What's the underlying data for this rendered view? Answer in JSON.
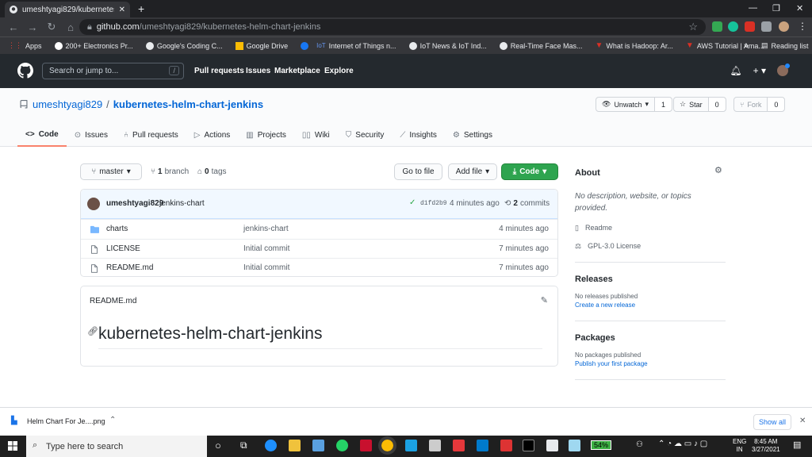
{
  "browser": {
    "tab_title": "umeshtyagi829/kubernetes-helm",
    "new_tab": "+",
    "window_controls": {
      "minimize": "—",
      "maximize": "❐",
      "close": "✕"
    },
    "url_host": "github.com",
    "url_path": "/umeshtyagi829/kubernetes-helm-chart-jenkins",
    "bookmarks": [
      {
        "label": "Apps",
        "color": "#ea4335"
      },
      {
        "label": "200+ Electronics Pr...",
        "color": "#ffffff"
      },
      {
        "label": "Google's Coding C...",
        "color": "#e8eaed"
      },
      {
        "label": "Google Drive",
        "color": "#fbbc04"
      },
      {
        "label": "Internet of Things n...",
        "color": "#1877f2"
      },
      {
        "label": "IoT News & IoT Ind...",
        "color": "#e8eaed"
      },
      {
        "label": "Real-Time Face Mas...",
        "color": "#e8eaed"
      },
      {
        "label": "What is Hadoop: Ar...",
        "color": "#d93025"
      },
      {
        "label": "AWS Tutorial | Ama...",
        "color": "#d93025"
      }
    ],
    "reading_list": "Reading list",
    "more": "»"
  },
  "github_header": {
    "search_placeholder": "Search or jump to...",
    "search_shortcut": "/",
    "nav": [
      "Pull requests",
      "Issues",
      "Marketplace",
      "Explore"
    ]
  },
  "repo": {
    "owner": "umeshtyagi829",
    "separator": "/",
    "name": "kubernetes-helm-chart-jenkins",
    "unwatch_label": "Unwatch",
    "watch_count": "1",
    "star_label": "Star",
    "star_count": "0",
    "fork_label": "Fork",
    "fork_count": "0",
    "tabs": [
      "Code",
      "Issues",
      "Pull requests",
      "Actions",
      "Projects",
      "Wiki",
      "Security",
      "Insights",
      "Settings"
    ]
  },
  "toolbar": {
    "branch": "master",
    "branch_count": "1",
    "branch_word": "branch",
    "tag_count": "0",
    "tag_word": "tags",
    "goto_file": "Go to file",
    "add_file": "Add file",
    "code": "Code"
  },
  "latest_commit": {
    "author": "umeshtyagi829",
    "message": "jenkins-chart",
    "hash": "d1fd2b9",
    "time": "4 minutes ago",
    "commit_count": "2",
    "commit_word": "commits"
  },
  "files": [
    {
      "name": "charts",
      "type": "dir",
      "message": "jenkins-chart",
      "age": "4 minutes ago"
    },
    {
      "name": "LICENSE",
      "type": "file",
      "message": "Initial commit",
      "age": "7 minutes ago"
    },
    {
      "name": "README.md",
      "type": "file",
      "message": "Initial commit",
      "age": "7 minutes ago"
    }
  ],
  "readme": {
    "filename": "README.md",
    "heading": "kubernetes-helm-chart-jenkins"
  },
  "sidebar": {
    "about_title": "About",
    "description": "No description, website, or topics provided.",
    "readme_link": "Readme",
    "license": "GPL-3.0 License",
    "releases_title": "Releases",
    "releases_none": "No releases published",
    "releases_create": "Create a new release",
    "packages_title": "Packages",
    "packages_none": "No packages published",
    "packages_publish": "Publish your first package"
  },
  "downloads": {
    "file": "Helm Chart For Je....png",
    "show_all": "Show all"
  },
  "taskbar": {
    "search_placeholder": "Type here to search",
    "battery": "54%",
    "lang_top": "ENG",
    "lang_bottom": "IN",
    "time": "8:45 AM",
    "date": "3/27/2021"
  }
}
